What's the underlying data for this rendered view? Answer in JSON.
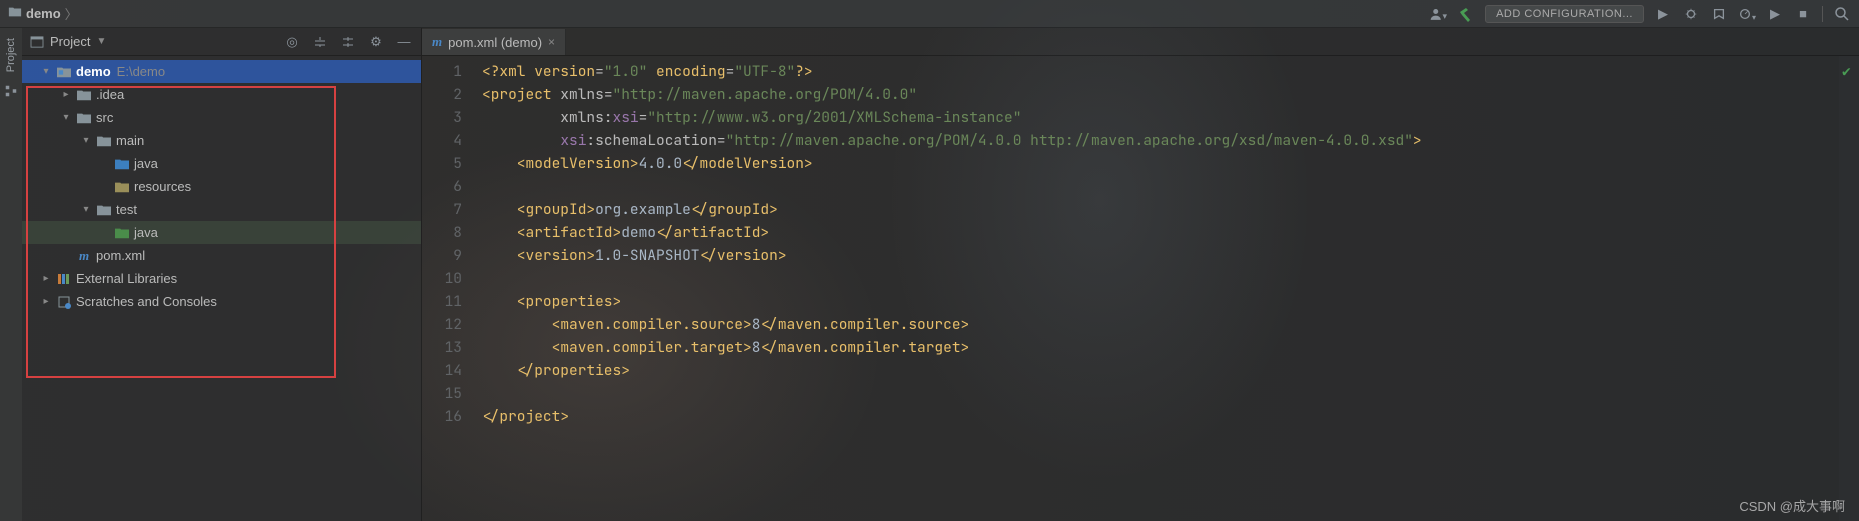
{
  "breadcrumb": {
    "project": "demo"
  },
  "toolbar": {
    "run_config": "ADD CONFIGURATION..."
  },
  "project_panel": {
    "title": "Project",
    "root": {
      "name": "demo",
      "path": "E:\\demo"
    },
    "idea": ".idea",
    "src": "src",
    "main": "main",
    "java1": "java",
    "resources": "resources",
    "test": "test",
    "java2": "java",
    "pom": "pom.xml",
    "ext_lib": "External Libraries",
    "scratches": "Scratches and Consoles"
  },
  "left_gutter": {
    "label": "Project"
  },
  "tab": {
    "filename": "pom.xml (demo)"
  },
  "gutter_lines": [
    "1",
    "2",
    "3",
    "4",
    "5",
    "6",
    "7",
    "8",
    "9",
    "10",
    "11",
    "12",
    "13",
    "14",
    "15",
    "16"
  ],
  "code": {
    "l1": {
      "a": "<?",
      "b": "xml version",
      "c": "=",
      "d": "\"1.0\"",
      "e": " encoding",
      "f": "=",
      "g": "\"UTF-8\"",
      "h": "?>"
    },
    "l2": {
      "a": "<",
      "b": "project",
      "c": " xmlns",
      "d": "=",
      "e": "\"http://maven.apache.org/POM/4.0.0\""
    },
    "l3": {
      "a": "         xmlns:",
      "b": "xsi",
      "c": "=",
      "d": "\"http://www.w3.org/2001/XMLSchema-instance\""
    },
    "l4": {
      "a": "         ",
      "b": "xsi",
      "c": ":schemaLocation",
      "d": "=",
      "e": "\"http://maven.apache.org/POM/4.0.0 http://maven.apache.org/xsd/maven-4.0.0.xsd\"",
      "f": ">"
    },
    "l5": {
      "a": "    <",
      "b": "modelVersion",
      "c": ">",
      "d": "4.0.0",
      "e": "</",
      "f": "modelVersion",
      "g": ">"
    },
    "l7": {
      "a": "    <",
      "b": "groupId",
      "c": ">",
      "d": "org.example",
      "e": "</",
      "f": "groupId",
      "g": ">"
    },
    "l8": {
      "a": "    <",
      "b": "artifactId",
      "c": ">",
      "d": "demo",
      "e": "</",
      "f": "artifactId",
      "g": ">"
    },
    "l9": {
      "a": "    <",
      "b": "version",
      "c": ">",
      "d": "1.0-SNAPSHOT",
      "e": "</",
      "f": "version",
      "g": ">"
    },
    "l11": {
      "a": "    <",
      "b": "properties",
      "c": ">"
    },
    "l12": {
      "a": "        <",
      "b": "maven.compiler.source",
      "c": ">",
      "d": "8",
      "e": "</",
      "f": "maven.compiler.source",
      "g": ">"
    },
    "l13": {
      "a": "        <",
      "b": "maven.compiler.target",
      "c": ">",
      "d": "8",
      "e": "</",
      "f": "maven.compiler.target",
      "g": ">"
    },
    "l14": {
      "a": "    </",
      "b": "properties",
      "c": ">"
    },
    "l16": {
      "a": "</",
      "b": "project",
      "c": ">"
    }
  },
  "watermark": "CSDN @成大事啊"
}
